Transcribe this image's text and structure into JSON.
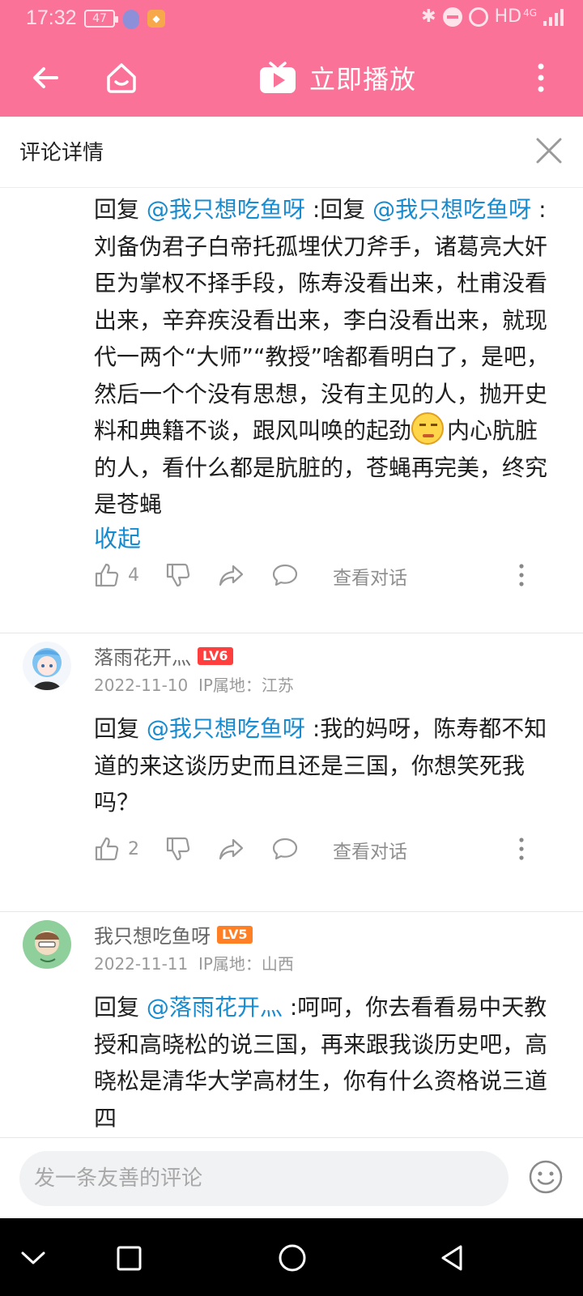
{
  "status_bar": {
    "time": "17:32",
    "battery": "47",
    "network": "HD",
    "network_gen": "4G"
  },
  "toolbar": {
    "play_title": "立即播放"
  },
  "detail_header": {
    "title": "评论详情"
  },
  "first_comment": {
    "prefix": "回复 ",
    "mention_1": "@我只想吃鱼呀",
    "middle": " :回复 ",
    "mention_2": "@我只想吃鱼呀",
    "suffix": " :",
    "body_before_emoji": "刘备伪君子白帝托孤埋伏刀斧手，诸葛亮大奸臣为掌权不择手段，陈寿没看出来，杜甫没看出来，辛弃疾没看出来，李白没看出来，就现代一两个“大师”“教授”啥都看明白了，是吧，然后一个个没有思想，没有主见的人，抛开史料和典籍不谈，跟风叫唤的起劲",
    "body_after_emoji": "内心肮脏的人，看什么都是肮脏的，苍蝇再完美，终究是苍蝇",
    "emoji": "smirk-emoji",
    "collapse_label": "收起",
    "likes": "4",
    "view_conversation": "查看对话"
  },
  "comments": [
    {
      "username": "落雨花开灬",
      "level": "LV6",
      "date": "2022-11-10",
      "ip_label": "IP属地：江苏",
      "prefix": "回复 ",
      "mention": "@我只想吃鱼呀",
      "text": " :我的妈呀，陈寿都不知道的来这谈历史而且还是三国，你想笑死我吗？",
      "likes": "2",
      "view_conversation": "查看对话"
    },
    {
      "username": "我只想吃鱼呀",
      "level": "LV5",
      "date": "2022-11-11",
      "ip_label": "IP属地：山西",
      "prefix": "回复 ",
      "mention": "@落雨花开灬",
      "text": " :呵呵，你去看看易中天教授和高晓松的说三国，再来跟我谈历史吧，高晓松是清华大学高材生，你有什么资格说三道四"
    }
  ],
  "bottom_bar": {
    "input_placeholder": "发一条友善的评论"
  },
  "colors": {
    "brand_pink": "#fb7299",
    "mention_blue": "#178bcf",
    "level6": "#ff3e3e",
    "level5": "#ff7f24"
  }
}
